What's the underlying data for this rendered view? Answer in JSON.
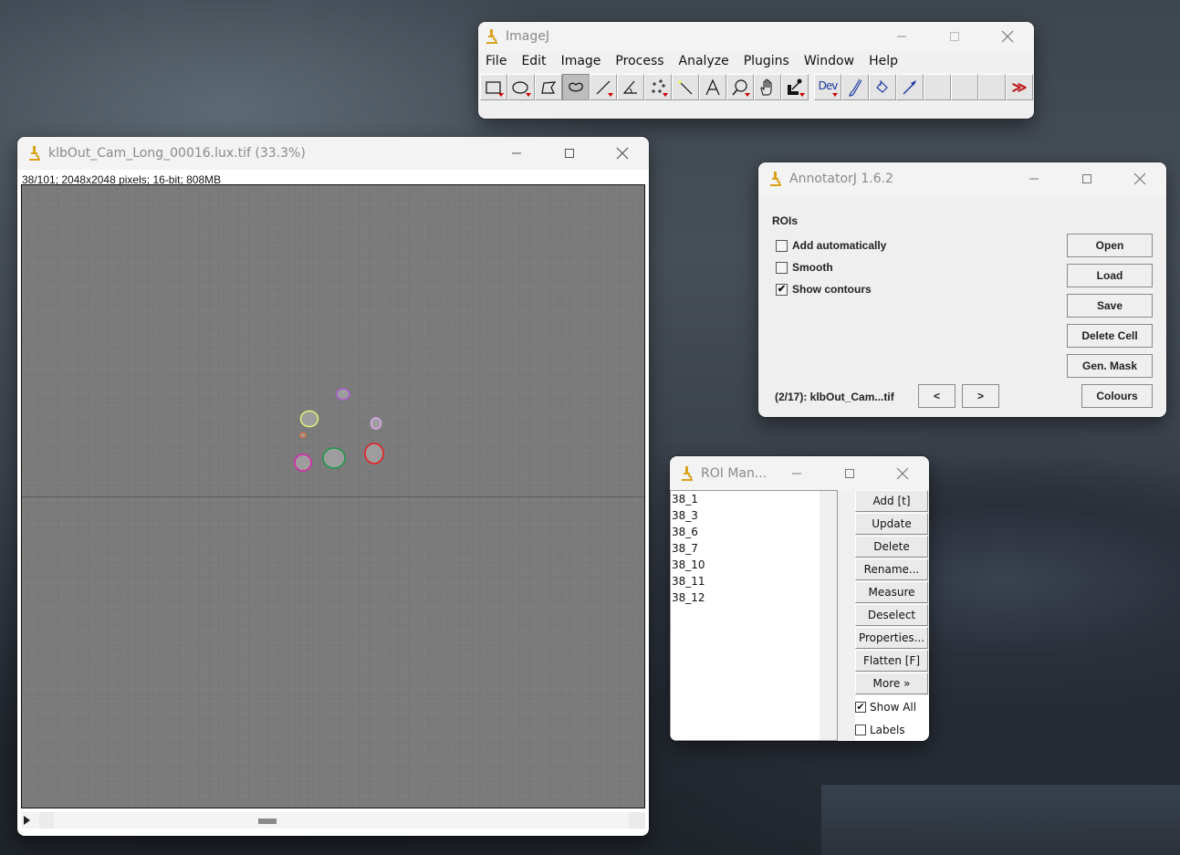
{
  "imagej": {
    "title": "ImageJ",
    "menu": [
      "File",
      "Edit",
      "Image",
      "Process",
      "Analyze",
      "Plugins",
      "Window",
      "Help"
    ],
    "tools": [
      {
        "name": "rectangle-tool",
        "dropdown": true,
        "selected": false
      },
      {
        "name": "oval-tool",
        "dropdown": true,
        "selected": false
      },
      {
        "name": "polygon-tool",
        "dropdown": false,
        "selected": false
      },
      {
        "name": "freehand-tool",
        "dropdown": false,
        "selected": true
      },
      {
        "name": "line-tool",
        "dropdown": true,
        "selected": false
      },
      {
        "name": "angle-tool",
        "dropdown": false,
        "selected": false
      },
      {
        "name": "multipoint-tool",
        "dropdown": true,
        "selected": false
      },
      {
        "name": "wand-tool",
        "dropdown": false,
        "selected": false
      },
      {
        "name": "text-tool",
        "dropdown": false,
        "selected": false
      },
      {
        "name": "magnifier-tool",
        "dropdown": true,
        "selected": false
      },
      {
        "name": "hand-tool",
        "dropdown": false,
        "selected": false
      },
      {
        "name": "color-picker-tool",
        "dropdown": true,
        "selected": false
      },
      {
        "name": "dev-menu-tool",
        "label": "Dev",
        "dropdown": true,
        "selected": false
      },
      {
        "name": "brush-tool",
        "dropdown": false,
        "selected": false
      },
      {
        "name": "flood-fill-tool",
        "dropdown": false,
        "selected": false
      },
      {
        "name": "arrow-tool",
        "dropdown": false,
        "selected": false
      },
      {
        "name": "empty-slot-1",
        "dropdown": false,
        "selected": false
      },
      {
        "name": "empty-slot-2",
        "dropdown": false,
        "selected": false
      },
      {
        "name": "empty-slot-3",
        "dropdown": false,
        "selected": false
      },
      {
        "name": "more-tools",
        "label": "≫",
        "dropdown": false,
        "selected": false
      }
    ]
  },
  "image_window": {
    "title": "klbOut_Cam_Long_00016.lux.tif (33.3%)",
    "info": "38/101; 2048x2048 pixels; 16-bit; 808MB",
    "slice_current": 38,
    "slice_total": 101,
    "rois": [
      {
        "color": "#b45ad6"
      },
      {
        "color": "#e0f07a"
      },
      {
        "color": "#e0a8f0"
      },
      {
        "color": "#d07040"
      },
      {
        "color": "#ee1a1a"
      },
      {
        "color": "#e020b0"
      },
      {
        "color": "#1a9a4a"
      }
    ]
  },
  "annotatorj": {
    "title": "AnnotatorJ 1.6.2",
    "section": "ROIs",
    "checkboxes": [
      {
        "label": "Add automatically",
        "checked": false
      },
      {
        "label": "Smooth",
        "checked": false
      },
      {
        "label": "Show contours",
        "checked": true
      }
    ],
    "buttons": [
      "Open",
      "Load",
      "Save",
      "Delete Cell",
      "Gen. Mask",
      "Colours"
    ],
    "status": "(2/17): klbOut_Cam...tif",
    "prev_label": "<",
    "next_label": ">"
  },
  "roi_manager": {
    "title": "ROI Man...",
    "items": [
      "38_1",
      "38_3",
      "38_6",
      "38_7",
      "38_10",
      "38_11",
      "38_12"
    ],
    "buttons": [
      "Add [t]",
      "Update",
      "Delete",
      "Rename...",
      "Measure",
      "Deselect",
      "Properties...",
      "Flatten [F]",
      "More »"
    ],
    "checkboxes": [
      {
        "label": "Show All",
        "checked": true
      },
      {
        "label": "Labels",
        "checked": false
      }
    ]
  },
  "icons": {
    "app": "microscope-icon",
    "minimize": "minimize-icon",
    "maximize": "maximize-icon",
    "close": "close-icon"
  }
}
